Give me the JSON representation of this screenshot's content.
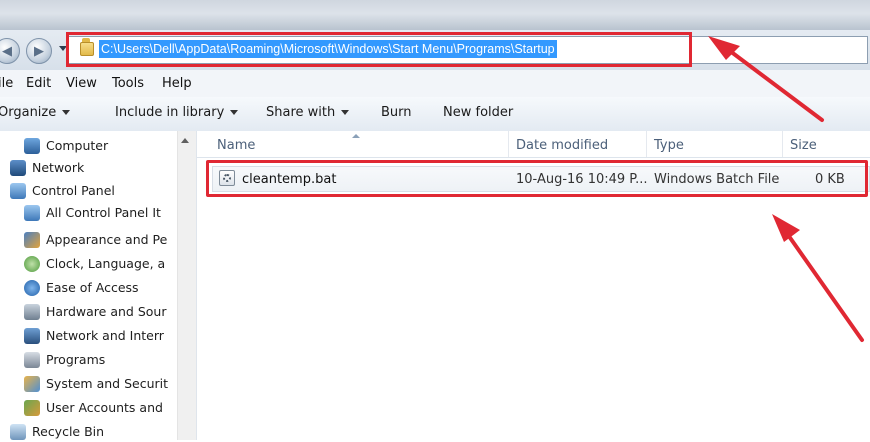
{
  "address_bar": {
    "path": "C:\\Users\\Dell\\AppData\\Roaming\\Microsoft\\Windows\\Start Menu\\Programs\\Startup"
  },
  "menu": [
    "ile",
    "Edit",
    "View",
    "Tools",
    "Help"
  ],
  "toolbar": {
    "organize": "Organize",
    "include_in_library": "Include in library",
    "share_with": "Share with",
    "burn": "Burn",
    "new_folder": "New folder"
  },
  "nav_pane": {
    "items": [
      {
        "label": "Computer",
        "icon": "computer-icon"
      },
      {
        "label": "Network",
        "icon": "network-icon"
      },
      {
        "label": "Control Panel",
        "icon": "control-panel-icon"
      },
      {
        "label": "All Control Panel It",
        "icon": "control-panel-icon"
      },
      {
        "label": "Appearance and Pe",
        "icon": "appearance-icon"
      },
      {
        "label": "Clock, Language, a",
        "icon": "clock-icon"
      },
      {
        "label": "Ease of Access",
        "icon": "ease-of-access-icon"
      },
      {
        "label": "Hardware and Sour",
        "icon": "hardware-icon"
      },
      {
        "label": "Network and Interr",
        "icon": "network-internet-icon"
      },
      {
        "label": "Programs",
        "icon": "programs-icon"
      },
      {
        "label": "System and Securit",
        "icon": "security-icon"
      },
      {
        "label": "User Accounts and",
        "icon": "user-accounts-icon"
      },
      {
        "label": "Recycle Bin",
        "icon": "recycle-bin-icon"
      }
    ]
  },
  "file_list": {
    "columns": [
      "Name",
      "Date modified",
      "Type",
      "Size"
    ],
    "rows": [
      {
        "name": "cleantemp.bat",
        "date_modified": "10-Aug-16 10:49 P...",
        "type": "Windows Batch File",
        "size": "0 KB"
      }
    ]
  },
  "colors": {
    "highlight_box": "#e02833",
    "annotation_arrow": "#e02833",
    "address_selection": "#3399ff"
  }
}
